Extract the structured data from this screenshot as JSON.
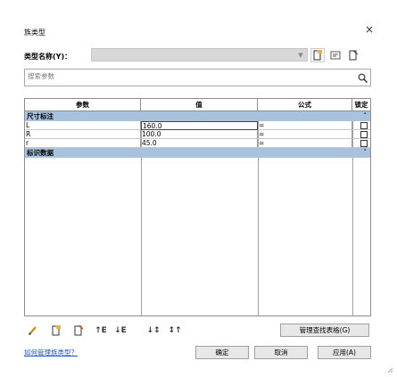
{
  "dialog": {
    "title": "族类型",
    "close_glyph": "×"
  },
  "type_name": {
    "label": "类型名称(Y)：",
    "value": ""
  },
  "toolbar_icons": [
    "new-type-icon",
    "rename-type-icon",
    "delete-type-icon"
  ],
  "search": {
    "placeholder": "搜索参数",
    "icon": "search-icon"
  },
  "table": {
    "headers": {
      "param": "参数",
      "value": "值",
      "formula": "公式",
      "lock": "锁定"
    },
    "groups": [
      {
        "name": "尺寸标注",
        "caret": "˄",
        "rows": [
          {
            "param": "L",
            "value": "160.0",
            "formula": "="
          },
          {
            "param": "R",
            "value": "100.0",
            "formula": "="
          },
          {
            "param": "r",
            "value": "45.0",
            "formula": "="
          }
        ]
      },
      {
        "name": "标识数据",
        "caret": "˅",
        "rows": []
      }
    ]
  },
  "bottom_icons": [
    "edit-param-icon",
    "new-param-icon",
    "delete-param-icon",
    "move-up-icon",
    "move-down-icon",
    "sort-asc-icon",
    "sort-desc-icon"
  ],
  "bottom_icon_glyphs": {
    "move_up": "↑E",
    "move_down": "↓E",
    "sort_asc": "↓↕",
    "sort_desc": "↕↑"
  },
  "buttons": {
    "manage_lookup": "管理查找表格(G)",
    "ok": "确定",
    "cancel": "取消",
    "apply": "应用(A)"
  },
  "help_link": "如何管理族类型？",
  "colors": {
    "group_band": "#a8c2dd",
    "link": "#1a55c0",
    "pencil": "#c08a1a",
    "icon_red": "#d04a22"
  }
}
